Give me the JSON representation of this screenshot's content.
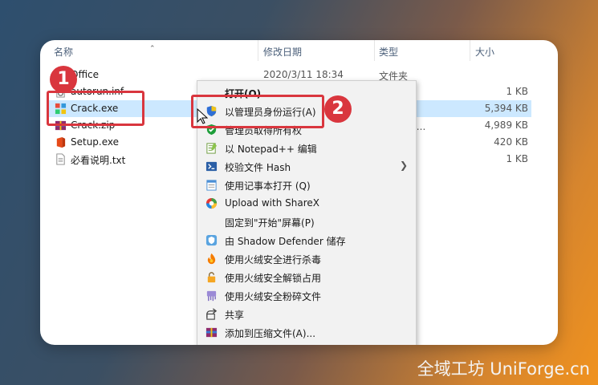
{
  "header": {
    "col_name": "名称",
    "col_date": "修改日期",
    "col_type": "类型",
    "col_size": "大小"
  },
  "files": [
    {
      "name": "Office",
      "date": "2020/3/11 18:34",
      "type": "文件夹",
      "size": "",
      "icon": "folder-icon"
    },
    {
      "name": "autorun.inf",
      "date": "",
      "type": "",
      "size": "1 KB",
      "icon": "settings-file-icon"
    },
    {
      "name": "Crack.exe",
      "date": "",
      "type": "",
      "size": "5,394 KB",
      "icon": "exe-icon"
    },
    {
      "name": "Crack.zip",
      "date": "",
      "type": "ZIP 压缩...",
      "size": "4,989 KB",
      "icon": "zip-archive-icon"
    },
    {
      "name": "Setup.exe",
      "date": "",
      "type": "",
      "size": "420 KB",
      "icon": "office-setup-icon"
    },
    {
      "name": "必看说明.txt",
      "date": "",
      "type": "",
      "size": "1 KB",
      "icon": "text-file-icon"
    }
  ],
  "context_menu": [
    {
      "label": "打开(O)",
      "icon": "",
      "bold": true
    },
    {
      "label": "以管理员身份运行(A)",
      "icon": "uac-shield-icon"
    },
    {
      "label": "管理员取得所有权",
      "icon": "green-check-shield-icon"
    },
    {
      "label": "以 Notepad++ 编辑",
      "icon": "notepadpp-icon"
    },
    {
      "label": "校验文件 Hash",
      "icon": "powershell-icon",
      "submenu": true
    },
    {
      "label": "使用记事本打开 (Q)",
      "icon": "notepad-icon"
    },
    {
      "label": "Upload with ShareX",
      "icon": "sharex-icon"
    },
    {
      "label": "固定到\"开始\"屏幕(P)",
      "icon": ""
    },
    {
      "label": "由 Shadow Defender 储存",
      "icon": "shadow-defender-icon"
    },
    {
      "label": "使用火绒安全进行杀毒",
      "icon": "huorong-icon"
    },
    {
      "label": "使用火绒安全解锁占用",
      "icon": "huorong-unlock-icon"
    },
    {
      "label": "使用火绒安全粉碎文件",
      "icon": "huorong-shred-icon"
    },
    {
      "label": "共享",
      "icon": "share-icon"
    },
    {
      "label": "添加到压缩文件(A)...",
      "icon": "winrar-icon"
    }
  ],
  "badges": {
    "first": "1",
    "second": "2"
  },
  "watermark": "全域工坊 UniForge.cn"
}
